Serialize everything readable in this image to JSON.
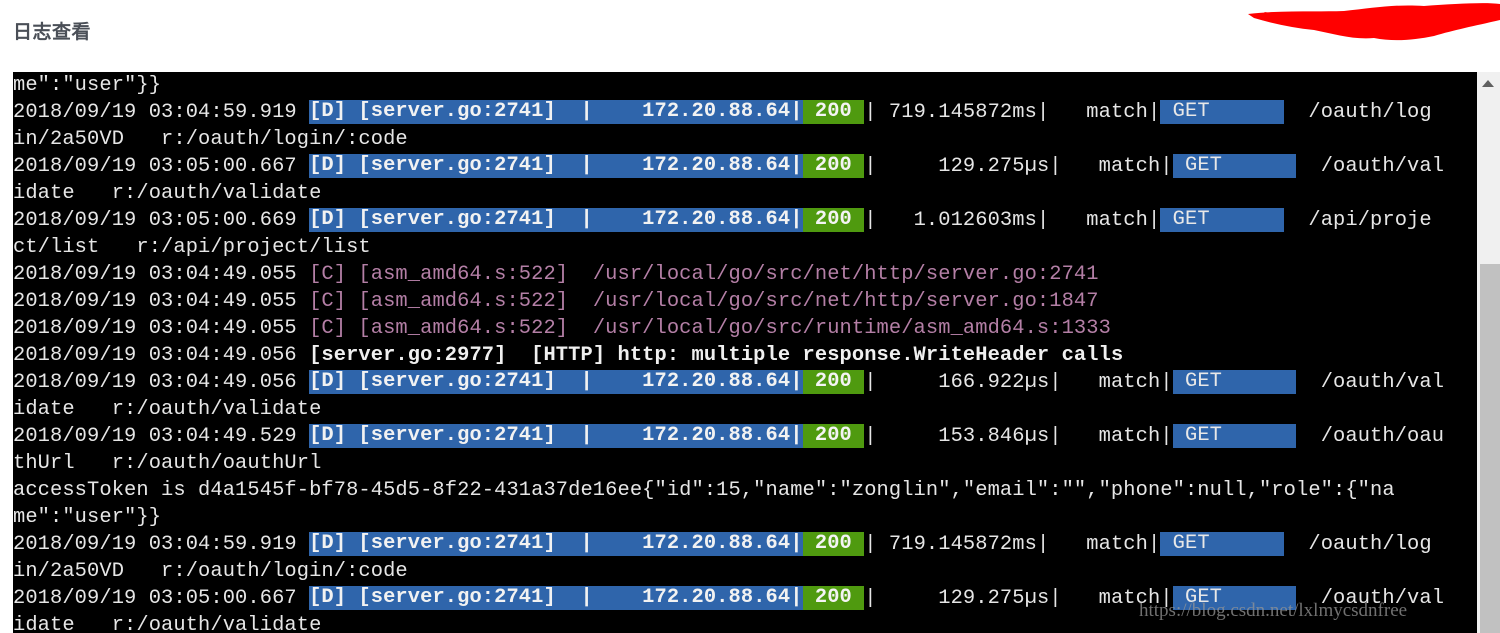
{
  "header": {
    "title": "日志查看",
    "redaction_color": "#ff0000"
  },
  "colors": {
    "terminal_bg": "#000000",
    "text": "#e6e6e6",
    "debug_bg": "#2f65ab",
    "status_ok_bg": "#4f9a0f",
    "critical_text": "#b47fa6"
  },
  "log": {
    "lines": [
      {
        "type": "plain",
        "text": "me\":\"user\"}}"
      },
      {
        "type": "request",
        "time": "2018/09/19 03:04:59.919 ",
        "tag": "[D] [server.go:2741]  |    172.20.88.64|",
        "status": " 200 ",
        "latency": "| 719.145872ms|   match|",
        "method": " GET      ",
        "path": "  /oauth/log"
      },
      {
        "type": "plain",
        "text": "in/2a50VD   r:/oauth/login/:code"
      },
      {
        "type": "request",
        "time": "2018/09/19 03:05:00.667 ",
        "tag": "[D] [server.go:2741]  |    172.20.88.64|",
        "status": " 200 ",
        "latency": "|     129.275µs|   match|",
        "method": " GET      ",
        "path": "  /oauth/val"
      },
      {
        "type": "plain",
        "text": "idate   r:/oauth/validate"
      },
      {
        "type": "request",
        "time": "2018/09/19 03:05:00.669 ",
        "tag": "[D] [server.go:2741]  |    172.20.88.64|",
        "status": " 200 ",
        "latency": "|   1.012603ms|   match|",
        "method": " GET      ",
        "path": "  /api/proje"
      },
      {
        "type": "plain",
        "text": "ct/list   r:/api/project/list"
      },
      {
        "type": "critical",
        "time": "2018/09/19 03:04:49.055 ",
        "text": "[C] [asm_amd64.s:522]  /usr/local/go/src/net/http/server.go:2741"
      },
      {
        "type": "critical",
        "time": "2018/09/19 03:04:49.055 ",
        "text": "[C] [asm_amd64.s:522]  /usr/local/go/src/net/http/server.go:1847"
      },
      {
        "type": "critical",
        "time": "2018/09/19 03:04:49.055 ",
        "text": "[C] [asm_amd64.s:522]  /usr/local/go/src/runtime/asm_amd64.s:1333"
      },
      {
        "type": "bold",
        "time": "2018/09/19 03:04:49.056 ",
        "text": "[server.go:2977]  [HTTP] http: multiple response.WriteHeader calls"
      },
      {
        "type": "request",
        "time": "2018/09/19 03:04:49.056 ",
        "tag": "[D] [server.go:2741]  |    172.20.88.64|",
        "status": " 200 ",
        "latency": "|     166.922µs|   match|",
        "method": " GET      ",
        "path": "  /oauth/val"
      },
      {
        "type": "plain",
        "text": "idate   r:/oauth/validate"
      },
      {
        "type": "request",
        "time": "2018/09/19 03:04:49.529 ",
        "tag": "[D] [server.go:2741]  |    172.20.88.64|",
        "status": " 200 ",
        "latency": "|     153.846µs|   match|",
        "method": " GET      ",
        "path": "  /oauth/oau"
      },
      {
        "type": "plain",
        "text": "thUrl   r:/oauth/oauthUrl"
      },
      {
        "type": "plain",
        "text": "accessToken is d4a1545f-bf78-45d5-8f22-431a37de16ee{\"id\":15,\"name\":\"zonglin\",\"email\":\"\",\"phone\":null,\"role\":{\"na"
      },
      {
        "type": "plain",
        "text": "me\":\"user\"}}"
      },
      {
        "type": "request",
        "time": "2018/09/19 03:04:59.919 ",
        "tag": "[D] [server.go:2741]  |    172.20.88.64|",
        "status": " 200 ",
        "latency": "| 719.145872ms|   match|",
        "method": " GET      ",
        "path": "  /oauth/log"
      },
      {
        "type": "plain",
        "text": "in/2a50VD   r:/oauth/login/:code"
      },
      {
        "type": "request",
        "time": "2018/09/19 03:05:00.667 ",
        "tag": "[D] [server.go:2741]  |    172.20.88.64|",
        "status": " 200 ",
        "latency": "|     129.275µs|   match|",
        "method": " GET      ",
        "path": "  /oauth/val"
      },
      {
        "type": "plain",
        "text": "idate   r:/oauth/validate"
      }
    ]
  },
  "scrollbar": {
    "up_arrow_icon": "triangle-up",
    "scroll_position_fraction": 0.34
  },
  "watermark": "https://blog.csdn.net/lxlmycsdnfree"
}
